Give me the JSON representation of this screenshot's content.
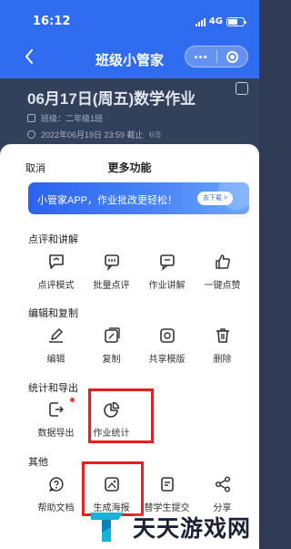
{
  "status": {
    "time": "16:12",
    "network": "4G"
  },
  "nav": {
    "title": "班级小管家"
  },
  "background_page": {
    "homework_title": "06月17日(周五)数学作业",
    "class_label": "班级：二年级1班",
    "deadline": "2022年06月19日 23:59 截止",
    "tag": "标签"
  },
  "sheet": {
    "cancel": "取消",
    "title": "更多功能",
    "banner": {
      "text": "小管家APP，作业批改更轻松！",
      "button": "去下载 >"
    },
    "sections": [
      {
        "title": "点评和讲解",
        "items": [
          "点评模式",
          "批量点评",
          "作业讲解",
          "一键点赞"
        ]
      },
      {
        "title": "编辑和复制",
        "items": [
          "编辑",
          "复制",
          "共享模版",
          "删除"
        ]
      },
      {
        "title": "统计和导出",
        "items": [
          "数据导出",
          "作业统计"
        ]
      },
      {
        "title": "其他",
        "items": [
          "帮助文档",
          "生成海报",
          "替学生提交",
          "分享"
        ]
      }
    ]
  },
  "watermark": {
    "text": "天天游戏网"
  },
  "colors": {
    "primary": "#2f6cf0",
    "highlight": "#e81f1f",
    "badge": "#ef3a3a"
  }
}
